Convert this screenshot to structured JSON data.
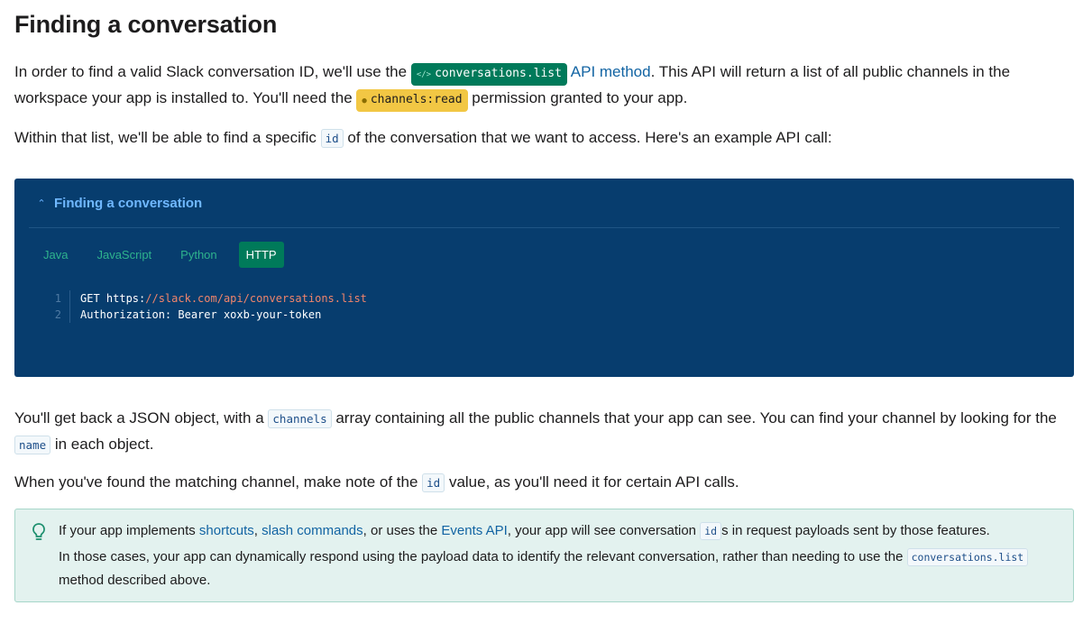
{
  "heading": "Finding a conversation",
  "intro": {
    "t1": "In order to find a valid Slack conversation ID, we'll use the ",
    "method_badge": "conversations.list",
    "method_link": "API method",
    "t2": ". This API will return a list of all public channels in the workspace your app is installed to. You'll need the ",
    "scope_badge": "channels:read",
    "t3": " permission granted to your app."
  },
  "within": {
    "t1": "Within that list, we'll be able to find a specific ",
    "code": "id",
    "t2": " of the conversation that we want to access. Here's an example API call:"
  },
  "codebox": {
    "title": "Finding a conversation",
    "tabs": [
      "Java",
      "JavaScript",
      "Python",
      "HTTP"
    ],
    "active_tab": "HTTP",
    "lines": [
      {
        "num": "1",
        "pre": "GET https:",
        "str": "//slack.com/api/conversations.list"
      },
      {
        "num": "2",
        "pre": "Authorization: Bearer xoxb-your-token",
        "str": ""
      }
    ]
  },
  "json_para": {
    "t1": "You'll get back a JSON object, with a ",
    "code1": "channels",
    "t2": " array containing all the public channels that your app can see. You can find your channel by looking for the ",
    "code2": "name",
    "t3": " in each object."
  },
  "found_para": {
    "t1": "When you've found the matching channel, make note of the ",
    "code": "id",
    "t2": " value, as you'll need it for certain API calls."
  },
  "tip": {
    "a1": "If your app implements ",
    "link1": "shortcuts",
    "a2": ", ",
    "link2": "slash commands",
    "a3": ", or uses the ",
    "link3": "Events API",
    "a4": ", your app will see conversation ",
    "code": "id",
    "a5": "s in request payloads sent by those features.",
    "b1": "In those cases, your app can dynamically respond using the payload data to identify the relevant conversation, rather than needing to use the ",
    "code2": "conversations.list",
    "b2": " method described above."
  },
  "colors": {
    "codebox_bg": "#073d6e",
    "tab_active": "#007a5a",
    "link": "#1264a3",
    "scope_badge": "#f2c744",
    "tip_bg": "#e3f2ef"
  }
}
